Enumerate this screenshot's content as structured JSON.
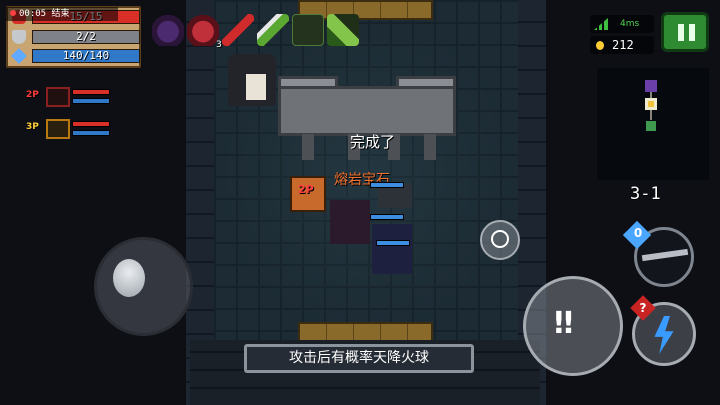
{
  "player": {
    "timer": "00:05",
    "timer_label": "结束",
    "hp": "15/15",
    "armor": "2/2",
    "energy": "140/140"
  },
  "party": [
    {
      "label": "2P"
    },
    {
      "label": "3P"
    }
  ],
  "buffs": {
    "level_label": "3"
  },
  "world": {
    "status_text": "完成了",
    "item_name": "熔岩宝石",
    "p2_tag": "2P"
  },
  "network": {
    "ping": "4ms"
  },
  "currency": {
    "coins": "212"
  },
  "stage": {
    "level": "3-1"
  },
  "weapon": {
    "ammo": "0"
  },
  "skill": {
    "badge": "?"
  },
  "tip": {
    "text": "攻击后有概率天降火球"
  },
  "colors": {
    "hp": "#d83028",
    "armor": "#7f8288",
    "energy": "#2f79c8",
    "pause": "#2e8b32"
  },
  "icons": [
    "heart-icon",
    "shield-icon",
    "energy-icon",
    "signal-icon",
    "coin-icon",
    "pause-icon",
    "lightning-icon",
    "attack-icon",
    "emote-icon"
  ]
}
